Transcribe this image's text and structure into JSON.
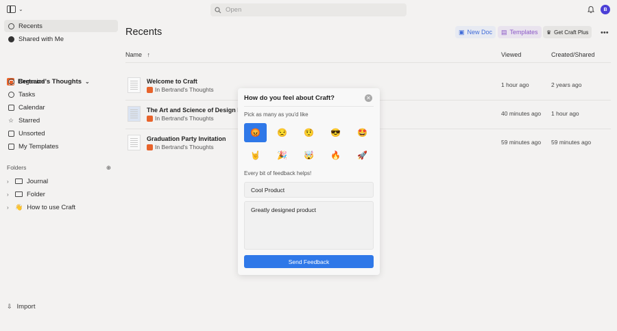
{
  "topbar": {
    "search_placeholder": "Open",
    "avatar_initial": "B"
  },
  "sidebar": {
    "nav": [
      {
        "label": "Recents",
        "icon": "clock-icon",
        "active": true
      },
      {
        "label": "Shared with Me",
        "icon": "shared-icon"
      }
    ],
    "space_name": "Bertrand's Thoughts",
    "space_items": [
      {
        "label": "Organize",
        "icon": "organize-icon"
      },
      {
        "label": "Tasks",
        "icon": "tasks-icon"
      },
      {
        "label": "Calendar",
        "icon": "calendar-icon"
      },
      {
        "label": "Starred",
        "icon": "star-icon"
      },
      {
        "label": "Unsorted",
        "icon": "unsorted-icon"
      },
      {
        "label": "My Templates",
        "icon": "templates-icon"
      }
    ],
    "folders_label": "Folders",
    "folders": [
      {
        "label": "Journal",
        "icon": "folder-icon"
      },
      {
        "label": "Folder",
        "icon": "folder-icon"
      },
      {
        "label": "How to use Craft",
        "icon": "wave-emoji-icon",
        "emoji": "👋"
      }
    ],
    "import_label": "Import"
  },
  "main": {
    "title": "Recents",
    "buttons": {
      "new_doc": "New Doc",
      "templates": "Templates",
      "get_plus": "Get Craft Plus"
    },
    "columns": {
      "name": "Name",
      "viewed": "Viewed",
      "created": "Created/Shared"
    },
    "rows": [
      {
        "title": "Welcome to Craft",
        "location": "In Bertrand's Thoughts",
        "viewed": "1 hour ago",
        "created": "2 years ago"
      },
      {
        "title": "The Art and Science of Design Engi",
        "location": "In Bertrand's Thoughts",
        "viewed": "40 minutes ago",
        "created": "1 hour ago"
      },
      {
        "title": "Graduation Party Invitation",
        "location": "In Bertrand's Thoughts",
        "viewed": "59 minutes ago",
        "created": "59 minutes ago"
      }
    ]
  },
  "modal": {
    "title": "How do you feel about Craft?",
    "pick_label": "Pick as many as you'd like",
    "emojis": [
      "😡",
      "😒",
      "🤨",
      "😎",
      "🤩",
      "🤘",
      "🎉",
      "🤯",
      "🔥",
      "🚀"
    ],
    "selected_index": 0,
    "help_label": "Every bit of feedback helps!",
    "input_value": "Cool Product",
    "textarea_value": "Greatly designed product",
    "send_label": "Send Feedback"
  },
  "colors": {
    "accent": "#2f78e8",
    "brand": "#e8632b",
    "avatar": "#4b3fd6",
    "templates": "#8a57c6"
  }
}
